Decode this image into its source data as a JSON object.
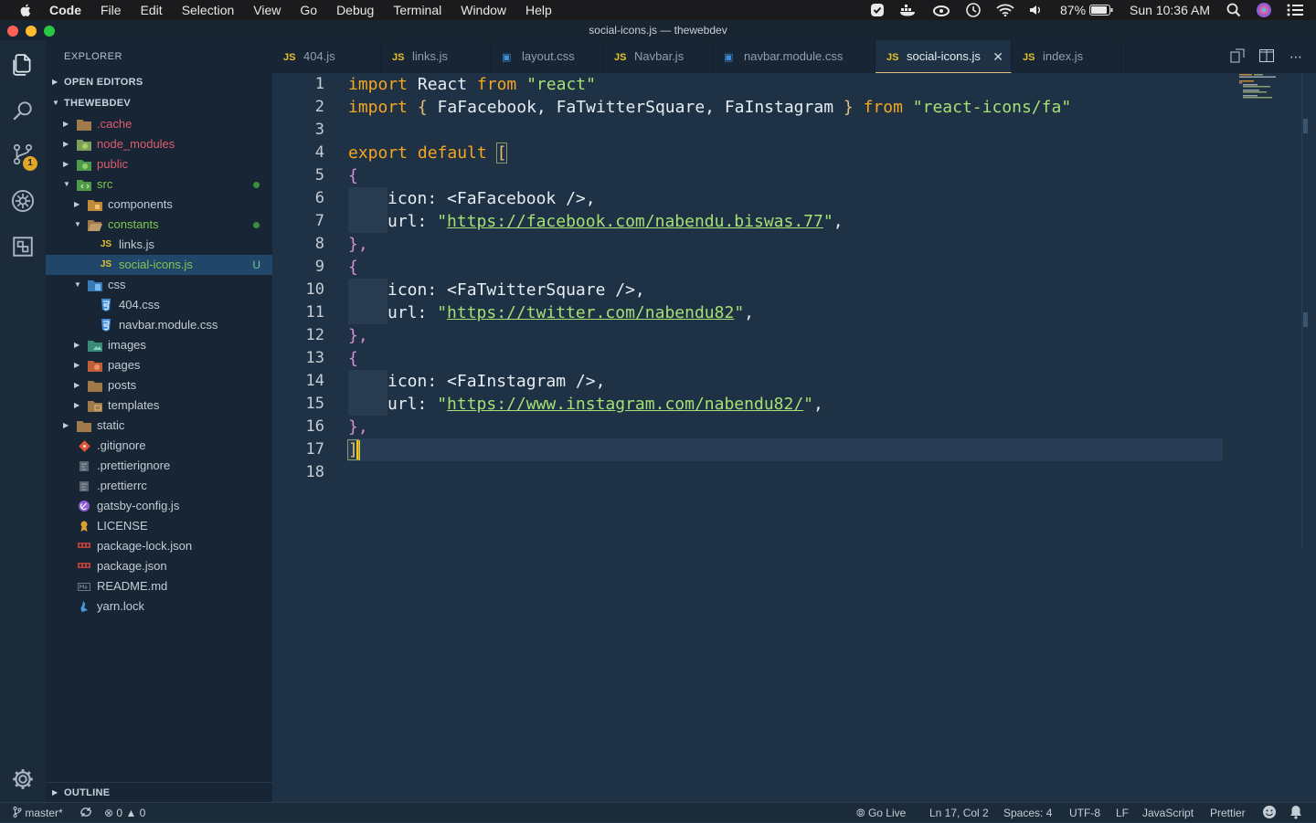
{
  "menubar": {
    "app_name": "Code",
    "items": [
      "File",
      "Edit",
      "Selection",
      "View",
      "Go",
      "Debug",
      "Terminal",
      "Window",
      "Help"
    ],
    "battery": "87%",
    "clock": "Sun 10:36 AM"
  },
  "window": {
    "title": "social-icons.js — thewebdev"
  },
  "activity_bar": {
    "scm_badge": "1"
  },
  "explorer": {
    "header": "EXPLORER",
    "open_editors": "OPEN EDITORS",
    "root": "THEWEBDEV",
    "outline": "OUTLINE",
    "items": [
      {
        "label": ".cache",
        "color": "#e05c6f"
      },
      {
        "label": "node_modules",
        "color": "#e05c6f"
      },
      {
        "label": "public",
        "color": "#e05c6f"
      },
      {
        "label": "src",
        "color": "#7ec850"
      },
      {
        "label": "components",
        "color": "#c4ccd4"
      },
      {
        "label": "constants",
        "color": "#7ec850"
      },
      {
        "label": "links.js",
        "color": "#c4ccd4"
      },
      {
        "label": "social-icons.js",
        "color": "#7ec850",
        "flag": "U"
      },
      {
        "label": "css",
        "color": "#c4ccd4"
      },
      {
        "label": "404.css",
        "color": "#c4ccd4"
      },
      {
        "label": "navbar.module.css",
        "color": "#c4ccd4"
      },
      {
        "label": "images",
        "color": "#c4ccd4"
      },
      {
        "label": "pages",
        "color": "#c4ccd4"
      },
      {
        "label": "posts",
        "color": "#c4ccd4"
      },
      {
        "label": "templates",
        "color": "#c4ccd4"
      },
      {
        "label": "static",
        "color": "#c4ccd4"
      },
      {
        "label": ".gitignore",
        "color": "#c4ccd4"
      },
      {
        "label": ".prettierignore",
        "color": "#c4ccd4"
      },
      {
        "label": ".prettierrc",
        "color": "#c4ccd4"
      },
      {
        "label": "gatsby-config.js",
        "color": "#c4ccd4"
      },
      {
        "label": "LICENSE",
        "color": "#c4ccd4"
      },
      {
        "label": "package-lock.json",
        "color": "#c4ccd4"
      },
      {
        "label": "package.json",
        "color": "#c4ccd4"
      },
      {
        "label": "README.md",
        "color": "#c4ccd4"
      },
      {
        "label": "yarn.lock",
        "color": "#c4ccd4"
      }
    ]
  },
  "tabs": [
    {
      "label": "404.js",
      "icon": "js-icon"
    },
    {
      "label": "links.js",
      "icon": "js-icon"
    },
    {
      "label": "layout.css",
      "icon": "css-icon"
    },
    {
      "label": "Navbar.js",
      "icon": "js-icon"
    },
    {
      "label": "navbar.module.css",
      "icon": "css-icon"
    },
    {
      "label": "social-icons.js",
      "icon": "js-icon",
      "active": true
    },
    {
      "label": "index.js",
      "icon": "js-icon"
    }
  ],
  "editor": {
    "line_numbers": [
      "1",
      "2",
      "3",
      "4",
      "5",
      "6",
      "7",
      "8",
      "9",
      "10",
      "11",
      "12",
      "13",
      "14",
      "15",
      "16",
      "17",
      "18"
    ],
    "code": {
      "l1_import": "import",
      "l1_react": " React ",
      "l1_from": "from",
      "l1_str": "\"react\"",
      "l2_import": "import",
      "l2_ob": "{",
      "l2_names": " FaFacebook, FaTwitterSquare, FaInstagram ",
      "l2_cb": "}",
      "l2_from": "from",
      "l2_str": "\"react-icons/fa\"",
      "l4_export": "export",
      "l4_default": "default",
      "l4_bracket": "[",
      "open_brace": "{",
      "close_brace": "},",
      "icon_key": "icon: ",
      "url_key": "url: ",
      "icon1": "<FaFacebook />,",
      "url1": "https://facebook.com/nabendu.biswas.77",
      "icon2": "<FaTwitterSquare />,",
      "url2": "https://twitter.com/nabendu82",
      "icon3": "<FaInstagram />,",
      "url3": "https://www.instagram.com/nabendu82/",
      "quote": "\"",
      "comma": ",",
      "l17_bracket": "]"
    }
  },
  "statusbar": {
    "branch": "master*",
    "errors": "0",
    "warnings": "0",
    "go_live": "Go Live",
    "position": "Ln 17, Col 2",
    "spaces": "Spaces: 4",
    "encoding": "UTF-8",
    "eol": "LF",
    "language": "JavaScript",
    "formatter": "Prettier"
  }
}
